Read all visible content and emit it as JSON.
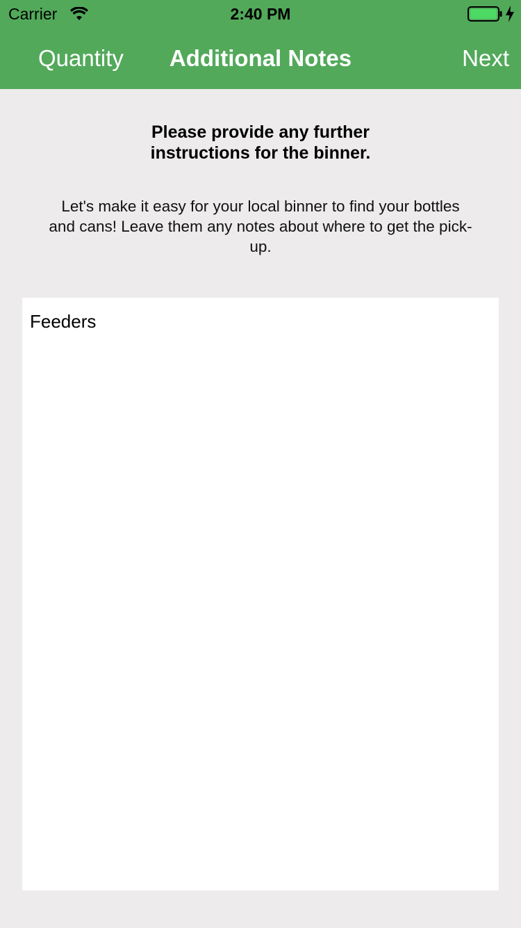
{
  "status_bar": {
    "carrier": "Carrier",
    "time": "2:40 PM",
    "wifi_icon": "wifi-icon",
    "battery_icon": "battery-icon",
    "charging_icon": "charging-bolt-icon",
    "battery_color": "#4cd964"
  },
  "nav": {
    "back_label": "Quantity",
    "title": "Additional Notes",
    "next_label": "Next",
    "background_color": "#52a95a"
  },
  "content": {
    "heading": "Please provide any further instructions for the binner.",
    "description": "Let's make it easy for your local binner to find your bottles and cans! Leave them any notes about where to get the pick-up.",
    "notes_value": "Feeders"
  }
}
